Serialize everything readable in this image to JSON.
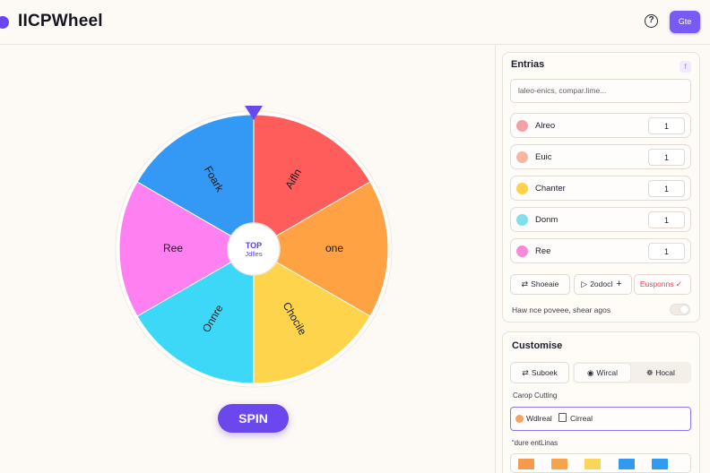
{
  "app": {
    "title": "IICPWheel",
    "top_button": "Gte",
    "help_icon": "?"
  },
  "colors": {
    "accent": "#6a48ee"
  },
  "wheel": {
    "segments": [
      {
        "label": "Aifln",
        "color": "#ff5c5c"
      },
      {
        "label": "one",
        "color": "#ffa244"
      },
      {
        "label": "Chocile",
        "color": "#ffd44d"
      },
      {
        "label": "Onnre",
        "color": "#3dd8f8"
      },
      {
        "label": "Ree",
        "color": "#ff80f0"
      },
      {
        "label": "Foark",
        "color": "#3399f5"
      }
    ],
    "center_line1": "TOP",
    "center_line2": "Jdlles",
    "spin_label": "SPIN"
  },
  "entries": {
    "title": "Entrias",
    "badge": "f",
    "search_value": "laleo-enics, compar.lime...",
    "items": [
      {
        "name": "Alreo",
        "qty": "1",
        "color": "#f4a0a8"
      },
      {
        "name": "Euic",
        "qty": "1",
        "color": "#f6b6a0"
      },
      {
        "name": "Chanter",
        "qty": "1",
        "color": "#fcd24a"
      },
      {
        "name": "Donm",
        "qty": "1",
        "color": "#7ee0ea"
      },
      {
        "name": "Ree",
        "qty": "1",
        "color": "#f78ad6"
      }
    ],
    "actions": {
      "shuffle": "Shoeaie",
      "add": "2odocl",
      "export": "Eusponns"
    },
    "hint": "Haw nce poveee, shear agos"
  },
  "customise": {
    "title": "Customise",
    "tabs": [
      "Suboek",
      "Wircal",
      "Hocal"
    ],
    "color_label": "Carop Cutting",
    "style_value": "Wdlreal",
    "style_value2": "Cirreal",
    "palette_label": "“dure entLinas",
    "palette": [
      "#f59a4a",
      "#f7a24d",
      "#fbd45a",
      "#3399ee",
      "#2f9cf0"
    ]
  }
}
